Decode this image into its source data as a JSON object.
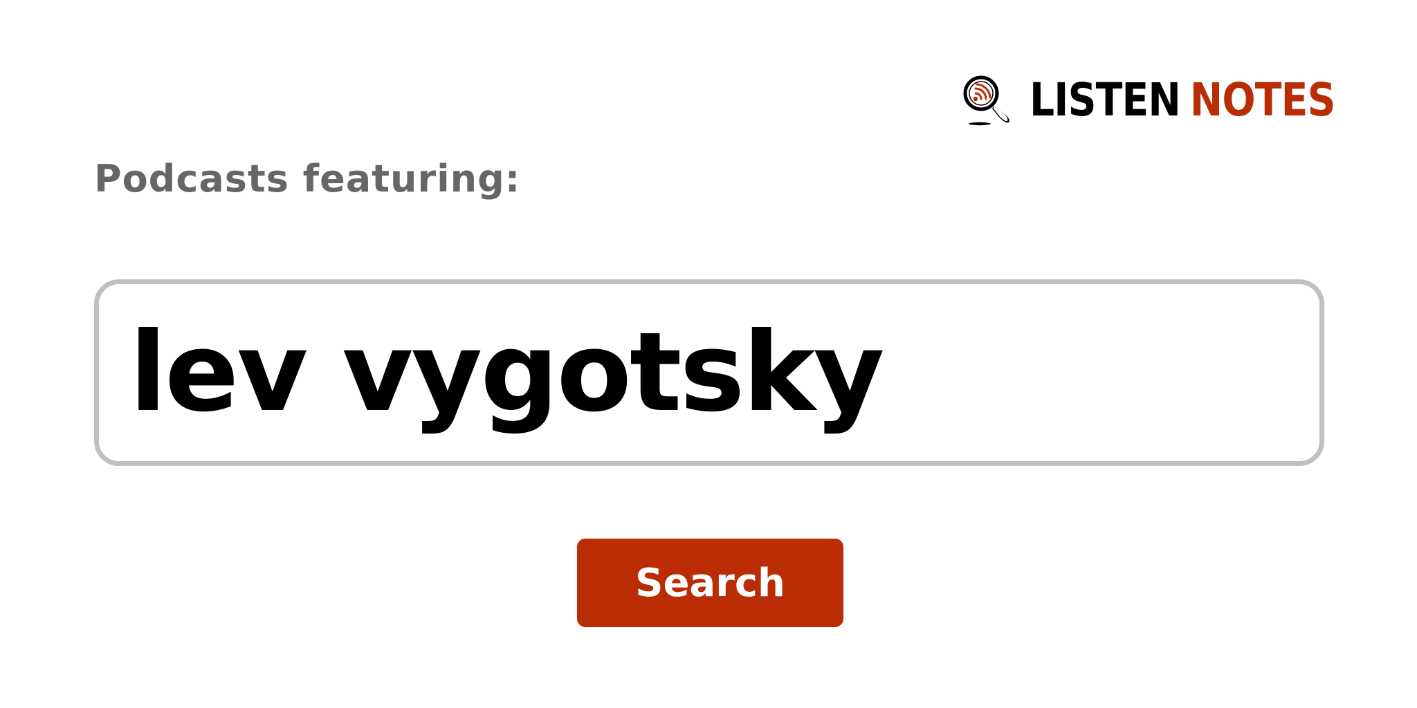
{
  "brand": {
    "word1": "LISTEN",
    "word2": "NOTES",
    "word1_color": "#000000",
    "word2_color": "#b92c04",
    "icon": "magnifier-podcast-icon"
  },
  "subtitle": "Podcasts featuring:",
  "search": {
    "value": "lev vygotsky",
    "border_color": "#c0c0c0"
  },
  "search_button": {
    "label": "Search",
    "color": "#b92c04"
  }
}
